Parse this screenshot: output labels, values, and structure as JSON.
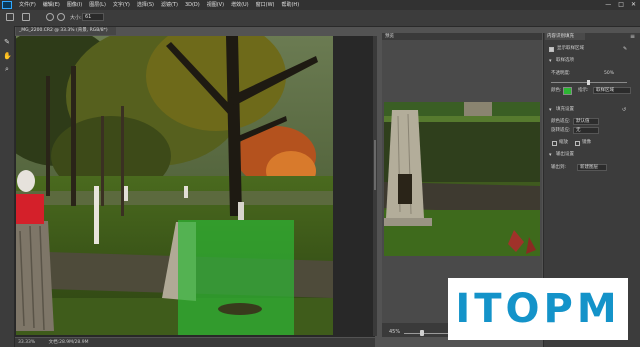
{
  "menubar": {
    "items": [
      "文件(F)",
      "编辑(E)",
      "图像(I)",
      "图层(L)",
      "文字(Y)",
      "选择(S)",
      "滤镜(T)",
      "3D(D)",
      "视图(V)",
      "增效(U)",
      "窗口(W)",
      "帮助(H)"
    ],
    "window_controls": [
      "—",
      "□",
      "✕"
    ]
  },
  "options": {
    "size_label": "大小:",
    "size_value": "61"
  },
  "tools": [
    "refine-edge-brush-icon",
    "hand-icon",
    "zoom-icon"
  ],
  "document": {
    "tab_label": "_MG_2200.CR2 @ 33.3% (背景, RGB/8*)",
    "zoom": "33.33%",
    "doc_info": "文档:28.9M/28.9M"
  },
  "preview": {
    "header_label": "预览",
    "zoom_label": "45%"
  },
  "panel": {
    "tab_label": "内容识别填充",
    "show_sampling_area_label": "显示取样区域",
    "sampling_overlay_section": "取样选项",
    "opacity_label": "不透明度:",
    "opacity_value": "50%",
    "color_label": "颜色:",
    "indicates_label": "指示:",
    "indicates_value": "取样区域",
    "fill_settings_section": "填充设置",
    "color_adapt_label": "颜色适应:",
    "color_adapt_value": "默认值",
    "rotation_adapt_label": "旋转适应:",
    "rotation_adapt_value": "无",
    "scale_label": "缩放",
    "mirror_label": "镜像",
    "output_settings_section": "输出设置",
    "output_to_label": "输出到:",
    "output_to_value": "新建图层",
    "overlay_color": "#2db634"
  },
  "watermark": {
    "text": "ITOPM"
  }
}
